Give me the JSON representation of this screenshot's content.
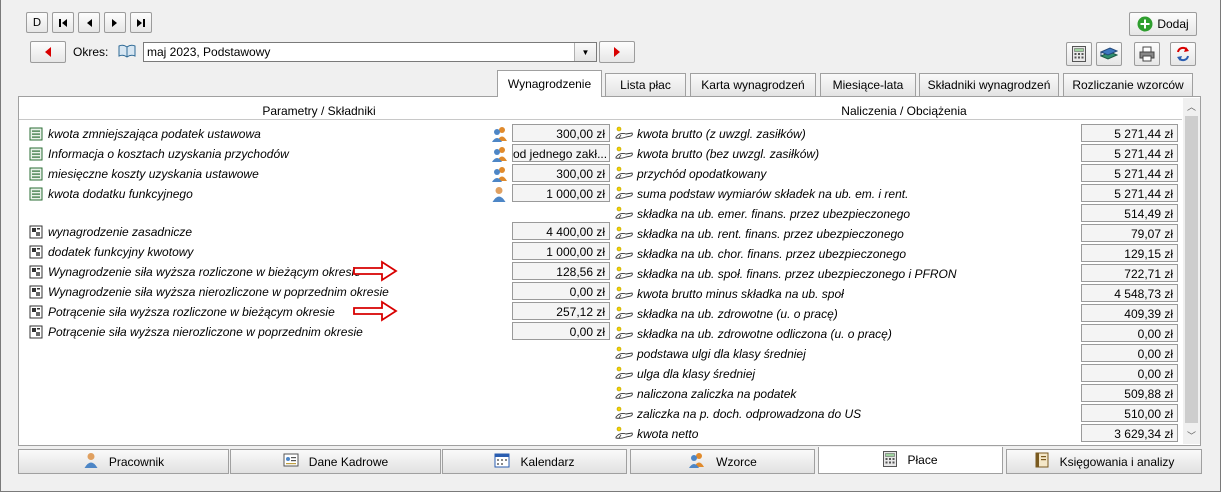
{
  "nav": {
    "new": "D",
    "first": "⏮",
    "prev": "◀",
    "next": "▶",
    "last": "⏭"
  },
  "toolbar": {
    "add_label": "Dodaj"
  },
  "period": {
    "label": "Okres:",
    "value": "maj 2023, Podstawowy"
  },
  "tabs": [
    {
      "label": "Wynagrodzenie",
      "active": true
    },
    {
      "label": "Lista płac",
      "active": false
    },
    {
      "label": "Karta wynagrodzeń",
      "active": false
    },
    {
      "label": "Miesiące-lata",
      "active": false
    },
    {
      "label": "Składniki wynagrodzeń",
      "active": false
    },
    {
      "label": "Rozliczanie wzorców",
      "active": false
    }
  ],
  "left": {
    "header": "Parametry / Składniki",
    "rows": [
      {
        "text": "kwota zmniejszająca podatek ustawowa",
        "value": "300,00 zł",
        "icon": "list-icon",
        "sub": "people-icon"
      },
      {
        "text": "Informacja o kosztach uzyskania przychodów",
        "value": "od jednego zakł...",
        "icon": "list-icon",
        "sub": "people-icon"
      },
      {
        "text": "miesięczne koszty uzyskania ustawowe",
        "value": "300,00 zł",
        "icon": "list-icon",
        "sub": "people-icon"
      },
      {
        "text": "kwota dodatku funkcyjnego",
        "value": "1 000,00 zł",
        "icon": "list-icon",
        "sub": "person-icon"
      },
      {
        "text": "wynagrodzenie zasadnicze",
        "value": "4 400,00 zł",
        "icon": "component-icon"
      },
      {
        "text": "dodatek funkcyjny kwotowy",
        "value": "1 000,00 zł",
        "icon": "component-icon"
      },
      {
        "text": "Wynagrodzenie siła wyższa rozliczone w bieżącym okresie",
        "value": "128,56 zł",
        "icon": "component-icon",
        "arrow": true
      },
      {
        "text": "Wynagrodzenie siła wyższa nierozliczone w poprzednim okresie",
        "value": "0,00 zł",
        "icon": "component-icon"
      },
      {
        "text": "Potrącenie siła wyższa rozliczone w bieżącym okresie",
        "value": "257,12 zł",
        "icon": "component-icon",
        "arrow": true
      },
      {
        "text": "Potrącenie siła wyższa nierozliczone w poprzednim okresie",
        "value": "0,00 zł",
        "icon": "component-icon"
      }
    ]
  },
  "right": {
    "header": "Naliczenia / Obciążenia",
    "rows": [
      {
        "text": "kwota brutto (z uwzgl. zasiłków)",
        "value": "5 271,44 zł"
      },
      {
        "text": "kwota brutto (bez uwzgl. zasiłków)",
        "value": "5 271,44 zł"
      },
      {
        "text": "przychód opodatkowany",
        "value": "5 271,44 zł"
      },
      {
        "text": "suma podstaw wymiarów składek na ub. em. i rent.",
        "value": "5 271,44 zł"
      },
      {
        "text": "składka na ub. emer. finans. przez ubezpieczonego",
        "value": "514,49 zł"
      },
      {
        "text": "składka na ub. rent. finans. przez ubezpieczonego",
        "value": "79,07 zł"
      },
      {
        "text": "składka na ub. chor. finans. przez ubezpieczonego",
        "value": "129,15 zł"
      },
      {
        "text": "składka na ub. społ. finans. przez ubezpieczonego i PFRON",
        "value": "722,71 zł"
      },
      {
        "text": "kwota brutto minus składka na ub. społ",
        "value": "4 548,73 zł"
      },
      {
        "text": "składka na ub. zdrowotne (u. o pracę)",
        "value": "409,39 zł"
      },
      {
        "text": "składka na ub. zdrowotne odliczona (u. o pracę)",
        "value": "0,00 zł"
      },
      {
        "text": "podstawa ulgi dla klasy średniej",
        "value": "0,00 zł"
      },
      {
        "text": "ulga dla klasy średniej",
        "value": "0,00 zł"
      },
      {
        "text": "naliczona zaliczka na podatek",
        "value": "509,88 zł"
      },
      {
        "text": "zaliczka na p. doch. odprowadzona do US",
        "value": "510,00 zł"
      },
      {
        "text": "kwota netto",
        "value": "3 629,34 zł"
      }
    ]
  },
  "bottom_tabs": [
    {
      "label": "Pracownik",
      "icon": "person-icon",
      "active": false
    },
    {
      "label": "Dane Kadrowe",
      "icon": "card-icon",
      "active": false
    },
    {
      "label": "Kalendarz",
      "icon": "calendar-icon",
      "active": false
    },
    {
      "label": "Wzorce",
      "icon": "people-icon",
      "active": false
    },
    {
      "label": "Płace",
      "icon": "calculator-icon",
      "active": true
    },
    {
      "label": "Księgowania i analizy",
      "icon": "ledger-icon",
      "active": false
    }
  ],
  "colors": {
    "accent_red": "#d80000",
    "add_green": "#2e9e2e",
    "panel_border": "#a0a0a0"
  }
}
